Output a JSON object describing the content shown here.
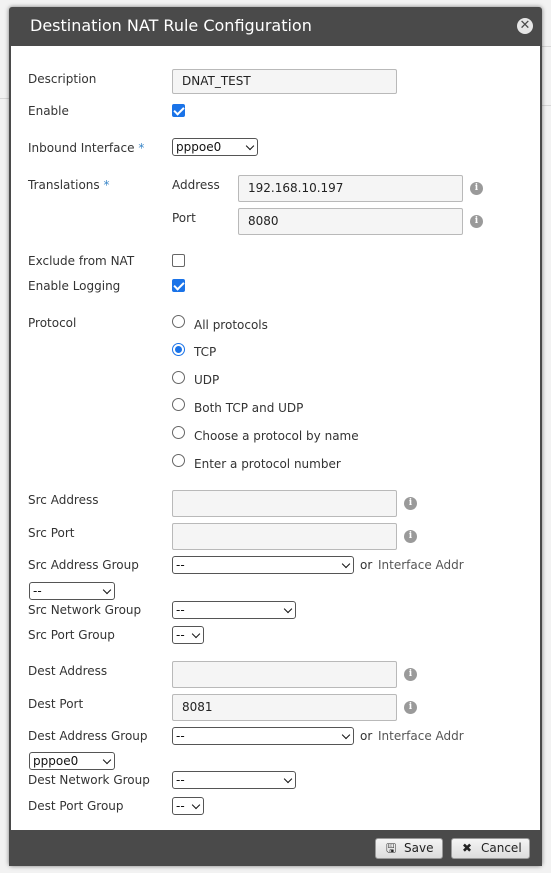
{
  "dialog": {
    "title": "Destination NAT Rule Configuration",
    "close_glyph": "✕"
  },
  "fields": {
    "description": {
      "label": "Description",
      "value": "DNAT_TEST"
    },
    "enable": {
      "label": "Enable",
      "checked": true
    },
    "inbound_interface": {
      "label": "Inbound Interface",
      "required": "*",
      "value": "pppoe0"
    },
    "translations": {
      "label": "Translations",
      "required": "*",
      "address_label": "Address",
      "address_value": "192.168.10.197",
      "port_label": "Port",
      "port_value": "8080"
    },
    "exclude_from_nat": {
      "label": "Exclude from NAT",
      "checked": false
    },
    "enable_logging": {
      "label": "Enable Logging",
      "checked": true
    },
    "protocol": {
      "label": "Protocol",
      "options": [
        "All protocols",
        "TCP",
        "UDP",
        "Both TCP and UDP",
        "Choose a protocol by name",
        "Enter a protocol number"
      ],
      "selected": "TCP"
    },
    "src_address": {
      "label": "Src Address",
      "value": ""
    },
    "src_port": {
      "label": "Src Port",
      "value": ""
    },
    "src_address_group": {
      "label": "Src Address Group",
      "value": "--",
      "or": "or",
      "interface_addr_label": "Interface Addr",
      "interface_addr_value": "--"
    },
    "src_network_group": {
      "label": "Src Network Group",
      "value": "--"
    },
    "src_port_group": {
      "label": "Src Port Group",
      "value": "--"
    },
    "dest_address": {
      "label": "Dest Address",
      "value": ""
    },
    "dest_port": {
      "label": "Dest Port",
      "value": "8081"
    },
    "dest_address_group": {
      "label": "Dest Address Group",
      "value": "--",
      "or": "or",
      "interface_addr_label": "Interface Addr",
      "interface_addr_value": "pppoe0"
    },
    "dest_network_group": {
      "label": "Dest Network Group",
      "value": "--"
    },
    "dest_port_group": {
      "label": "Dest Port Group",
      "value": "--"
    }
  },
  "footer": {
    "save_label": "Save",
    "save_icon": "floppy-disk-icon",
    "cancel_label": "Cancel",
    "cancel_icon": "x-icon"
  },
  "icons": {
    "info_glyph": "i"
  },
  "colors": {
    "accent": "#1a73e8",
    "dialog_frame": "#4a4a4a",
    "required_star": "#3a86c8"
  }
}
